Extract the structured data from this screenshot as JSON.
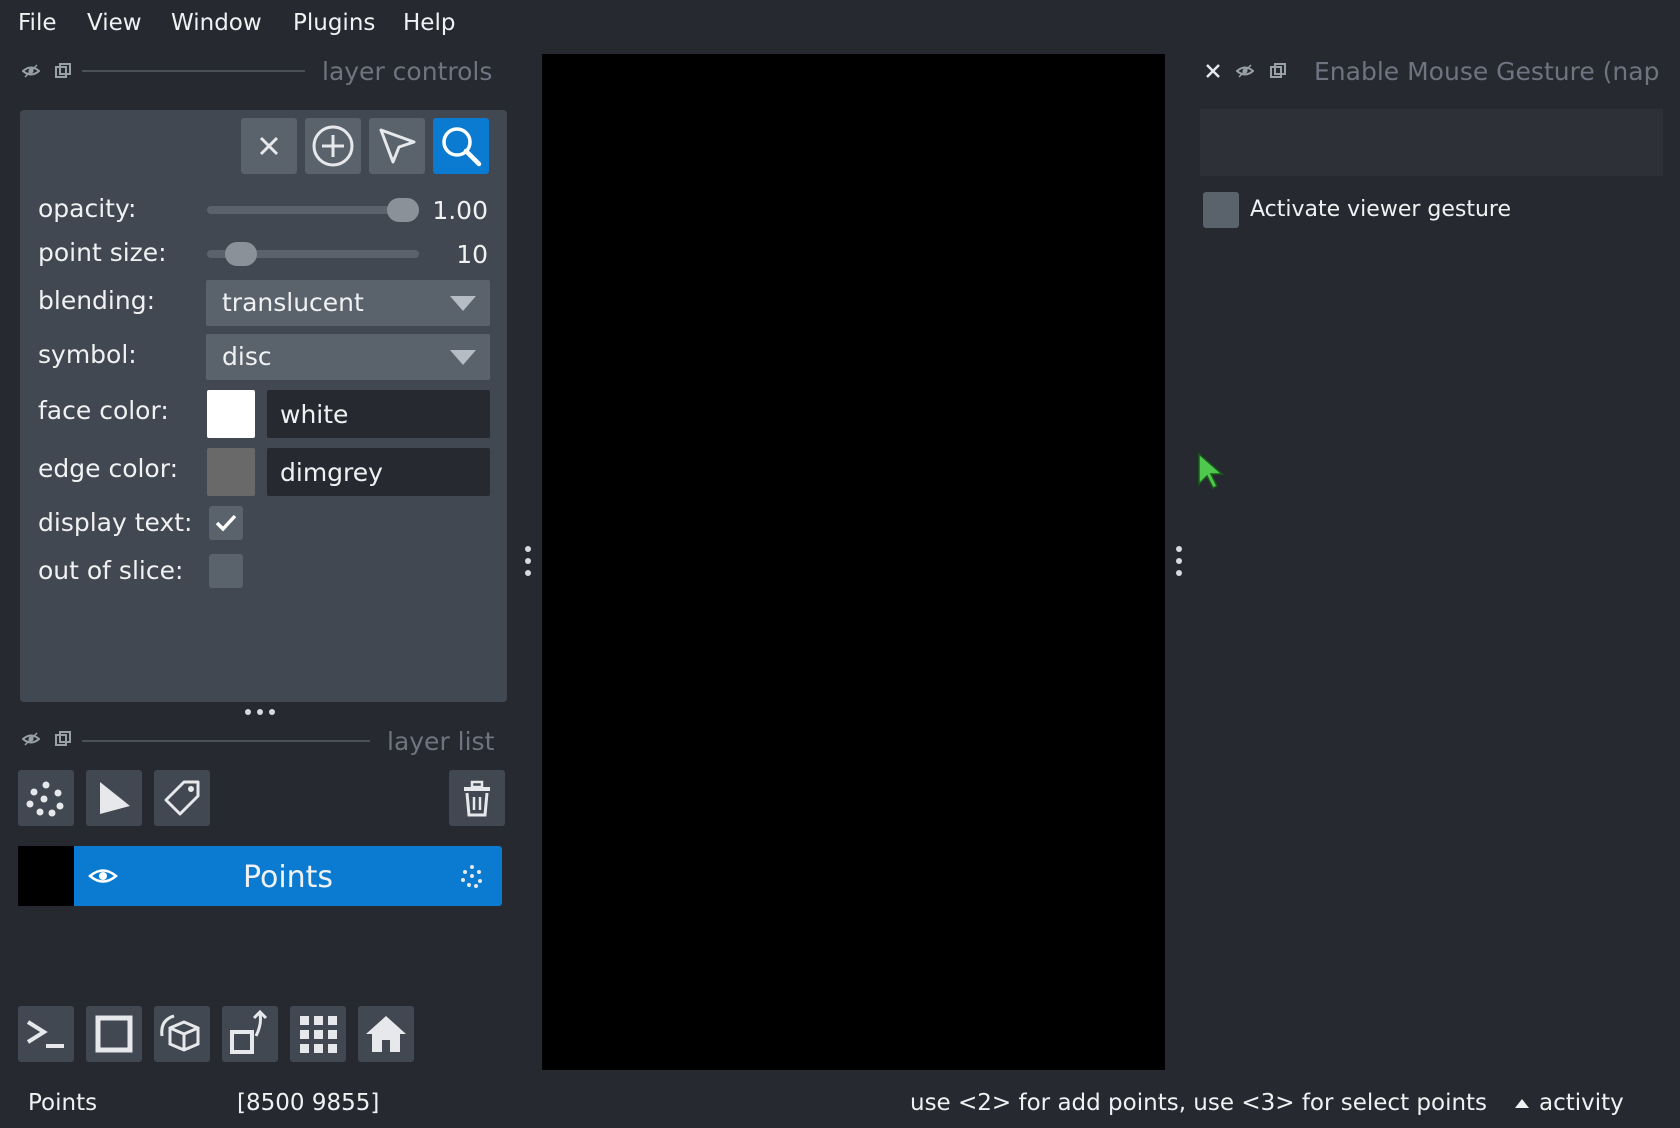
{
  "menu": {
    "items": [
      "File",
      "View",
      "Window",
      "Plugins",
      "Help"
    ]
  },
  "layer_controls": {
    "title": "layer controls",
    "opacity": {
      "label": "opacity:",
      "value": "1.00",
      "level": 1.0
    },
    "point_size": {
      "label": "point size:",
      "value": "10",
      "level": 0.1
    },
    "blending": {
      "label": "blending:",
      "value": "translucent"
    },
    "symbol": {
      "label": "symbol:",
      "value": "disc"
    },
    "face_color": {
      "label": "face color:",
      "value": "white",
      "swatch": "#ffffff"
    },
    "edge_color": {
      "label": "edge color:",
      "value": "dimgrey",
      "swatch": "#696969"
    },
    "display_text": {
      "label": "display text:",
      "checked": true
    },
    "out_of_slice": {
      "label": "out of slice:",
      "checked": false
    }
  },
  "layer_list": {
    "title": "layer list",
    "layers": [
      {
        "name": "Points",
        "visible": true,
        "selected": true
      }
    ]
  },
  "right_dock": {
    "title": "Enable Mouse Gesture (nap",
    "checkbox_label": "Activate viewer gesture",
    "checked": false
  },
  "status": {
    "layer": "Points",
    "coords": "[8500 9855]",
    "help": "use <2> for add points, use <3> for select points",
    "activity": "activity"
  },
  "colors": {
    "background": "#262930",
    "panel": "#414851",
    "accent": "#0b7ad1",
    "cursor": "#4ec94e"
  }
}
